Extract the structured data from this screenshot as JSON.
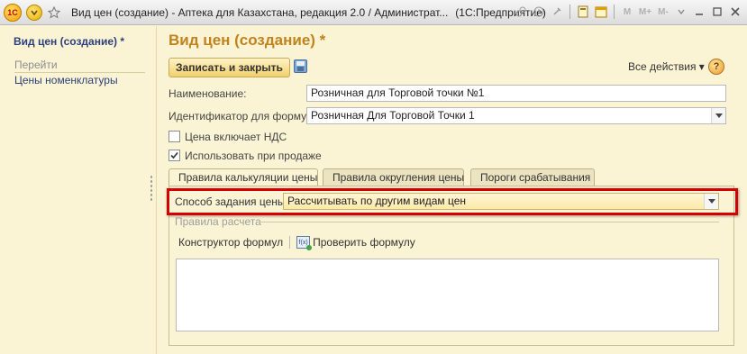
{
  "window": {
    "title": "Вид цен (создание) - Аптека для Казахстана, редакция 2.0 / Администрат...",
    "app_name": "(1С:Предприятие)",
    "logo_text": "1С"
  },
  "toolbar_right": {
    "m_label": "M",
    "m_plus_label": "M+",
    "m_minus_label": "M-"
  },
  "sidebar": {
    "title": "Вид цен (создание) *",
    "go_label": "Перейти",
    "links": [
      {
        "label": "Цены номенклатуры"
      }
    ]
  },
  "form": {
    "title": "Вид цен (создание) *",
    "save_close_label": "Записать и закрыть",
    "all_actions_label": "Все действия ▾",
    "help_label": "?",
    "name_label": "Наименование:",
    "name_value": "Розничная для Торговой точки №1",
    "id_label": "Идентификатор для формул:",
    "id_value": "Розничная Для Торговой Точки 1",
    "vat_label": "Цена включает НДС",
    "vat_checked": false,
    "use_sale_label": "Использовать при продаже",
    "use_sale_checked": true
  },
  "tabs": [
    {
      "label": "Правила калькуляции цены",
      "active": true
    },
    {
      "label": "Правила округления цены",
      "active": false
    },
    {
      "label": "Пороги срабатывания",
      "active": false
    }
  ],
  "calc_tab": {
    "method_label": "Способ задания цены:",
    "method_value": "Рассчитывать по другим видам цен",
    "rules_group_title": "Правила расчета",
    "formula_builder_label": "Конструктор формул",
    "check_formula_label": "Проверить формулу",
    "formula_text": ""
  },
  "colors": {
    "background": "#fbf4d4",
    "title_accent": "#c2821d",
    "link": "#2b3f7a",
    "highlight_border": "#d40000"
  }
}
